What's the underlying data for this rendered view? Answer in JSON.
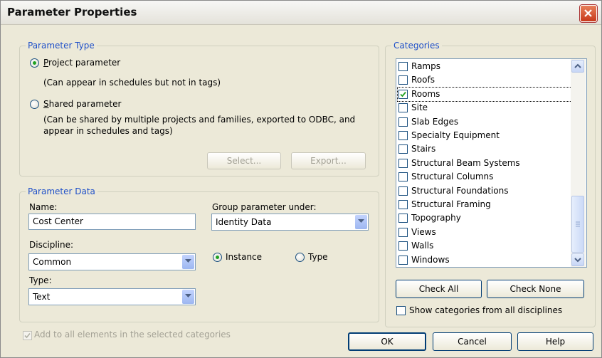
{
  "window": {
    "title": "Parameter Properties"
  },
  "parameter_type": {
    "legend": "Parameter Type",
    "project": {
      "label_u": "P",
      "label_rest": "roject parameter",
      "desc": "(Can appear in schedules but not in tags)",
      "selected": true
    },
    "shared": {
      "label_u": "S",
      "label_rest": "hared parameter",
      "desc_line1": "(Can be shared by multiple projects and families, exported to ODBC, and",
      "desc_line2": "appear in schedules and tags)",
      "selected": false
    },
    "select_label": "Select...",
    "export_label": "Export..."
  },
  "parameter_data": {
    "legend": "Parameter Data",
    "name_label": "Name:",
    "name_value": "Cost Center",
    "group_label": "Group parameter under:",
    "group_value": "Identity Data",
    "discipline_label": "Discipline:",
    "discipline_value": "Common",
    "type_label": "Type:",
    "type_value": "Text",
    "instance_label": "Instance",
    "type_radio_label": "Type",
    "instance_selected": true
  },
  "add_all_label": "Add to all elements in the selected categories",
  "categories": {
    "legend": "Categories",
    "items": [
      {
        "label": "Ramps",
        "checked": false
      },
      {
        "label": "Roofs",
        "checked": false
      },
      {
        "label": "Rooms",
        "checked": true
      },
      {
        "label": "Site",
        "checked": false
      },
      {
        "label": "Slab Edges",
        "checked": false
      },
      {
        "label": "Specialty Equipment",
        "checked": false
      },
      {
        "label": "Stairs",
        "checked": false
      },
      {
        "label": "Structural Beam Systems",
        "checked": false
      },
      {
        "label": "Structural Columns",
        "checked": false
      },
      {
        "label": "Structural Foundations",
        "checked": false
      },
      {
        "label": "Structural Framing",
        "checked": false
      },
      {
        "label": "Topography",
        "checked": false
      },
      {
        "label": "Views",
        "checked": false
      },
      {
        "label": "Walls",
        "checked": false
      },
      {
        "label": "Windows",
        "checked": false
      }
    ],
    "check_all_label": "Check All",
    "check_none_label": "Check None",
    "show_all_label": "Show categories from all disciplines"
  },
  "buttons": {
    "ok": "OK",
    "cancel": "Cancel",
    "help": "Help"
  }
}
